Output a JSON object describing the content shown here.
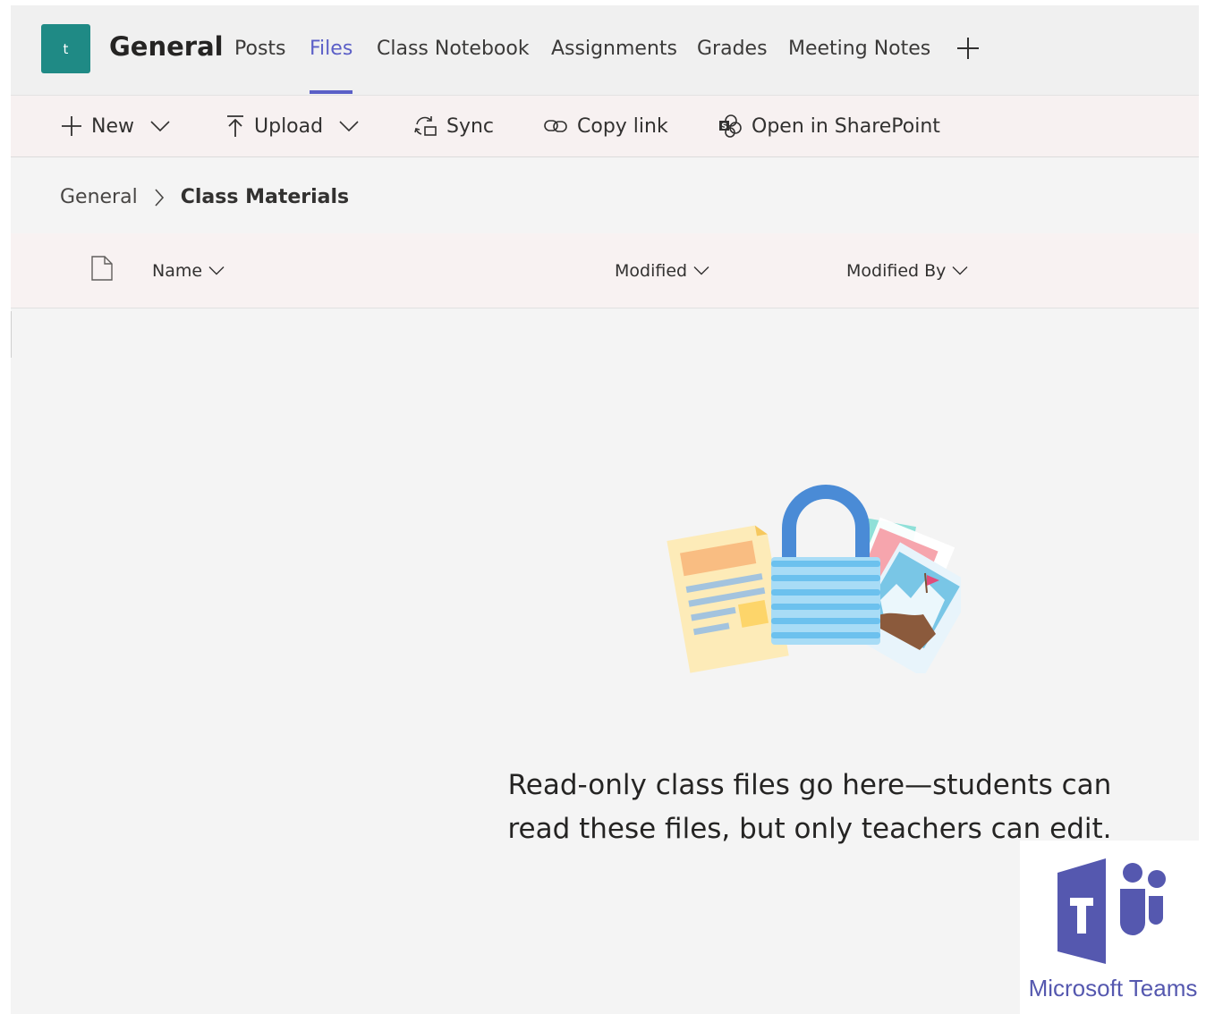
{
  "team": {
    "avatar_letter": "t",
    "channel": "General"
  },
  "tabs": [
    {
      "label": "Posts"
    },
    {
      "label": "Files",
      "active": true
    },
    {
      "label": "Class Notebook"
    },
    {
      "label": "Assignments"
    },
    {
      "label": "Grades"
    },
    {
      "label": "Meeting Notes"
    }
  ],
  "toolbar": {
    "new_label": "New",
    "upload_label": "Upload",
    "sync_label": "Sync",
    "copy_link_label": "Copy link",
    "sharepoint_label": "Open in SharePoint"
  },
  "breadcrumb": {
    "root": "General",
    "current": "Class Materials"
  },
  "columns": {
    "name": "Name",
    "modified": "Modified",
    "modified_by": "Modified By"
  },
  "empty_state": {
    "message": "Read-only class files go here—students can read these files, but only teachers can edit."
  },
  "logo": {
    "text": "Microsoft Teams"
  },
  "colors": {
    "accent": "#5b5fc7",
    "team_tile": "#1f8a85",
    "logo": "#5558af"
  },
  "icons": [
    "plus-icon",
    "chevron-down-icon",
    "upload-icon",
    "sync-icon",
    "link-icon",
    "sharepoint-icon",
    "chevron-right-icon",
    "document-icon",
    "lock-files-illustration",
    "teams-logo"
  ]
}
